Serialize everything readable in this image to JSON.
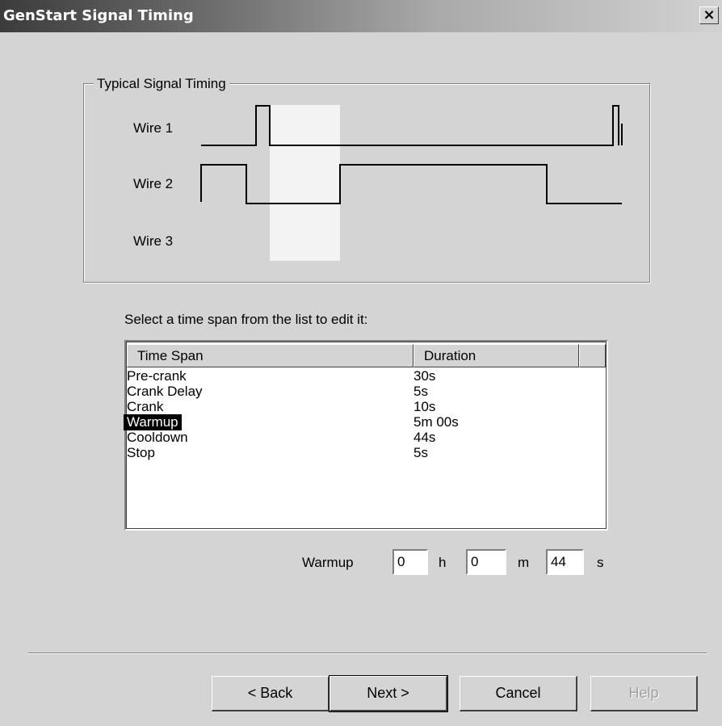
{
  "window": {
    "title": "GenStart Signal Timing",
    "close_label": "×"
  },
  "timing_group": {
    "label": "Typical Signal Timing",
    "wires": [
      "Wire 1",
      "Wire 2",
      "Wire 3"
    ]
  },
  "instruction": "Select a time span from the list to edit it:",
  "list": {
    "columns": [
      "Time Span",
      "Duration"
    ],
    "rows": [
      {
        "span": "Pre-crank",
        "duration": "30s"
      },
      {
        "span": "Crank Delay",
        "duration": "5s"
      },
      {
        "span": "Crank",
        "duration": "10s"
      },
      {
        "span": "Warmup",
        "duration": "5m 00s"
      },
      {
        "span": "Cooldown",
        "duration": "44s"
      },
      {
        "span": "Stop",
        "duration": "5s"
      }
    ],
    "selected": "Warmup"
  },
  "editor": {
    "label": "Warmup",
    "hours": "0",
    "hours_unit": "h",
    "minutes": "0",
    "minutes_unit": "m",
    "seconds": "44",
    "seconds_unit": "s"
  },
  "buttons": {
    "back": "< Back",
    "next": "Next >",
    "cancel": "Cancel",
    "help": "Help"
  },
  "colors": {
    "dialog_bg": "#d4d4d4",
    "highlight_band": "#f3f3f3",
    "selection_bg": "#000000"
  }
}
